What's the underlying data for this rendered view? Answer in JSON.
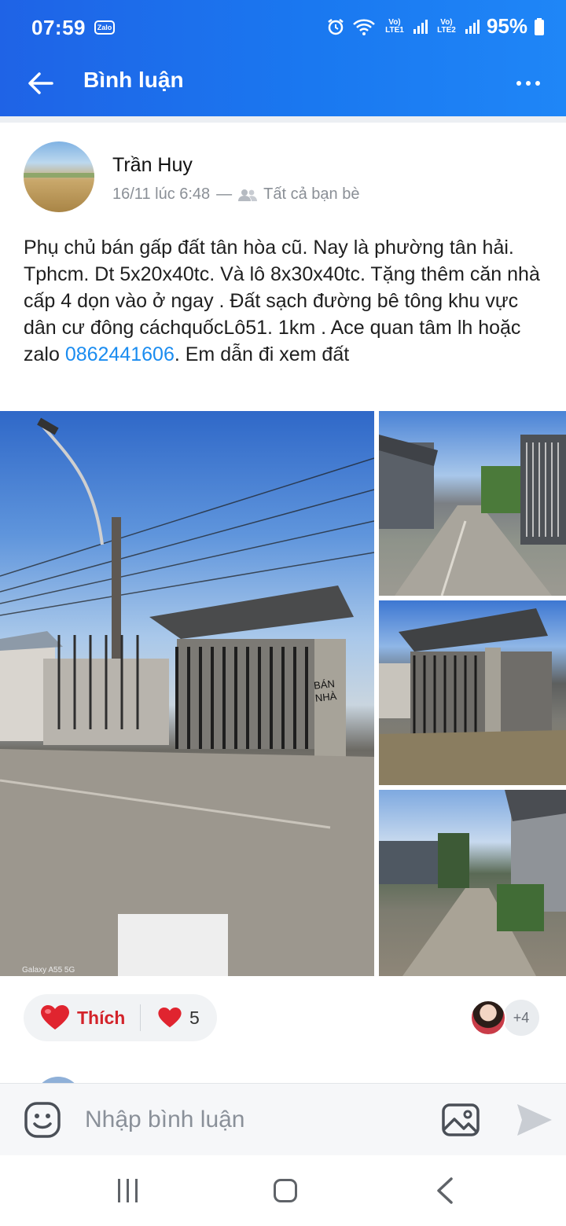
{
  "status_bar": {
    "time": "07:59",
    "zalo_badge": "Zalo",
    "sim1": "Vo) LTE1",
    "sim2": "Vo) LTE2",
    "battery": "95%"
  },
  "header": {
    "title": "Bình luận",
    "icons": [
      "back-arrow-icon",
      "more-options-icon"
    ]
  },
  "post": {
    "author": "Trần Huy",
    "timestamp": "16/11 lúc 6:48",
    "separator": "—",
    "privacy": "Tất cả bạn bè",
    "text_before_phone": "Phụ chủ bán gấp đất tân hòa cũ. Nay là phường tân hải. Tphcm. Dt 5x20x40tc. Và lô 8x30x40tc. Tặng thêm căn nhà cấp 4 dọn vào ở ngay . Đất sạch đường bê tông khu vực dân cư đông cáchquốcLô51. 1km . Ace quan tâm lh hoặc zalo ",
    "phone": "0862441606",
    "text_after_phone": ". Em dẫn đi xem đất",
    "photo_watermark": "Galaxy A55 5G",
    "gate_text": "BÁN NHÀ"
  },
  "reactions": {
    "like_label": "Thích",
    "count": "5",
    "more_reactors": "+4"
  },
  "comment_bar": {
    "placeholder": "Nhập bình luận",
    "icons": [
      "emoji-icon",
      "image-icon",
      "send-icon"
    ]
  },
  "colors": {
    "header_gradient_start": "#1f63e6",
    "header_gradient_end": "#1f86f7",
    "link": "#1a8cf0",
    "like_red": "#d3232a"
  }
}
